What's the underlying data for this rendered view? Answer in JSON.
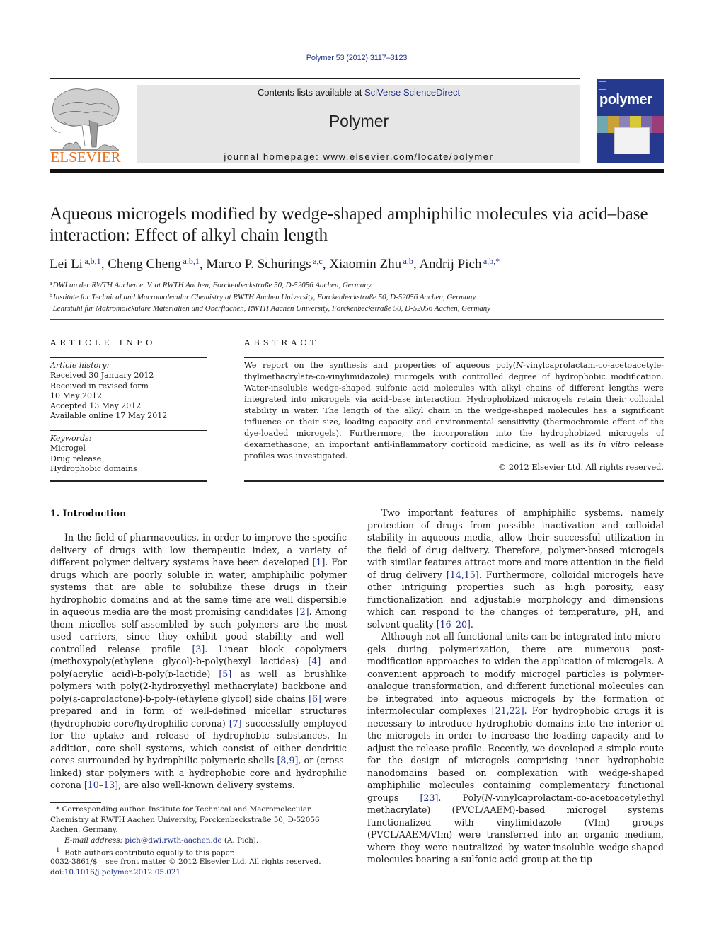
{
  "running_head": {
    "citation": "Polymer 53 (2012) 3117–3123"
  },
  "masthead": {
    "publisher_logo": "elsevier-tree-logo",
    "publisher_name": "ELSEVIER",
    "contents_prefix": "Contents lists available at ",
    "contents_link": "SciVerse ScienceDirect",
    "journal_title": "Polymer",
    "homepage_label": "journal homepage: www.elsevier.com/locate/polymer",
    "cover_title": "polymer",
    "colors": {
      "link": "#1f2f8a",
      "publisher_orange": "#e9711c",
      "masthead_bg": "#e6e6e6",
      "cover_blue": "#253a8e"
    }
  },
  "article": {
    "title": "Aqueous microgels modified by wedge-shaped amphiphilic molecules via acid–base interaction: Effect of alkyl chain length",
    "authors": [
      {
        "name": "Lei Li",
        "affil": "a,b,1",
        "sep": ", "
      },
      {
        "name": "Cheng Cheng",
        "affil": "a,b,1",
        "sep": ", "
      },
      {
        "name": "Marco P. Schürings",
        "affil": "a,c",
        "sep": ", "
      },
      {
        "name": "Xiaomin Zhu",
        "affil": "a,b",
        "sep": ", "
      },
      {
        "name": "Andrij Pich",
        "affil": "a,b,*",
        "sep": ""
      }
    ],
    "affiliations": [
      {
        "key": "a",
        "text": "DWI an der RWTH Aachen e. V. at RWTH Aachen, Forckenbeckstraße 50, D-52056 Aachen, Germany"
      },
      {
        "key": "b",
        "text": "Institute for Technical and Macromolecular Chemistry at RWTH Aachen University, Forckenbeckstraße 50, D-52056 Aachen, Germany"
      },
      {
        "key": "c",
        "text": "Lehrstuhl für Makromolekulare Materialien und Oberflächen, RWTH Aachen University, Forckenbeckstraße 50, D-52056 Aachen, Germany"
      }
    ]
  },
  "article_info": {
    "heading": "ARTICLE INFO",
    "history_label": "Article history:",
    "history": [
      "Received 30 January 2012",
      "Received in revised form",
      "10 May 2012",
      "Accepted 13 May 2012",
      "Available online 17 May 2012"
    ],
    "keywords_label": "Keywords:",
    "keywords": [
      "Microgel",
      "Drug release",
      "Hydrophobic domains"
    ]
  },
  "abstract": {
    "heading": "ABSTRACT",
    "text_1": "We report on the synthesis and properties of aqueous poly(",
    "text_1_italic": "N",
    "text_2": "-vinylcaprolactam-co-acetoacetyle­thylmethacrylate-co-vinylimidazole) microgels with controlled degree of hydrophobic modification. Water-insoluble wedge-shaped sulfonic acid molecules with alkyl chains of different lengths were integrated into microgels via acid–base interaction. Hydrophobized microgels retain their colloidal stability in water. The length of the alkyl chain in the wedge-shaped molecules has a significant influence on their size, loading capacity and environmental sensitivity (thermochromic effect of the dye-loaded microgels). Furthermore, the incorporation into the hydrophobized microgels of dexamethasone, an important anti-inflammatory corticoid medicine, as well as its ",
    "text_2_italic": "in vitro",
    "text_3": " release profiles was investigated.",
    "copyright": "© 2012 Elsevier Ltd. All rights reserved."
  },
  "body": {
    "section_heading": "1.  Introduction",
    "left_paragraph": [
      {
        "t": "In the field of pharmaceutics, in order to improve the specific delivery of drugs with low therapeutic index, a variety of different polymer delivery systems have been developed "
      },
      {
        "ref": "[1]"
      },
      {
        "t": ". For drugs which are poorly soluble in water, amphiphilic polymer systems that are able to solubilize these drugs in their hydrophobic domains and at the same time are well dispersible in aqueous media are the most promising candidates "
      },
      {
        "ref": "[2]"
      },
      {
        "t": ". Among them micelles self-assembled by such polymers are the most used carriers, since they exhibit good stability and well-controlled release profile "
      },
      {
        "ref": "[3]"
      },
      {
        "t": ". Linear block copolymers (methoxypoly(ethylene glycol)-b-poly(hexyl lactides) "
      },
      {
        "ref": "[4]"
      },
      {
        "t": " and poly(acrylic acid)-b-poly(ᴅ-lactide) "
      },
      {
        "ref": "[5]"
      },
      {
        "t": " as well as brushlike polymers with poly(2-hydroxyethyl methac­rylate) backbone and poly(ε-caprolactone)-b-poly-(ethylene glycol) side chains "
      },
      {
        "ref": "[6]"
      },
      {
        "t": " were prepared and in form of well-defined micellar structures (hydrophobic core/hydrophilic corona) "
      },
      {
        "ref": "[7]"
      },
      {
        "t": " successfully employed for the uptake and release of hydrophobic substances. In addition, core–shell systems, which consist of either dendritic cores surrounded by hydrophilic polymeric shells "
      },
      {
        "ref": "[8,9]"
      },
      {
        "t": ", or (cross-linked) star polymers with a hydrophobic core and hydrophilic corona "
      },
      {
        "ref": "[10–13]"
      },
      {
        "t": ", are also well-known delivery systems."
      }
    ],
    "right_paragraphs": [
      [
        {
          "t": "Two important features of amphiphilic systems, namely protection of drugs from possible inactivation and colloidal stability in aqueous media, allow their successful utilization in the field of drug delivery. Therefore, polymer-based microgels with similar features attract more and more attention in the field of drug delivery "
        },
        {
          "ref": "[14,15]"
        },
        {
          "t": ". Furthermore, colloidal microgels have other intriguing properties such as high porosity, easy functionalization and adjustable morphology and dimensions which can respond to the changes of temperature, pH, and solvent quality "
        },
        {
          "ref": "[16–20]"
        },
        {
          "t": "."
        }
      ],
      [
        {
          "t": "Although not all functional units can be integrated into micro­gels during polymerization, there are numerous post-modification approaches to widen the application of microgels. A convenient approach to modify microgel particles is polymer-analogue trans­formation, and different functional molecules can be integrated into aqueous microgels by the formation of intermolecular complexes "
        },
        {
          "ref": "[21,22]"
        },
        {
          "t": ". For hydrophobic drugs it is necessary to intro­duce hydrophobic domains into the interior of the microgels in order to increase the loading capacity and to adjust the release profile. Recently, we developed a simple route for the design of microgels comprising inner hydrophobic nanodomains based on complexation with wedge-shaped amphiphilic molecules con­taining complementary functional groups "
        },
        {
          "ref": "[23]"
        },
        {
          "t": ". Poly("
        },
        {
          "i": "N"
        },
        {
          "t": "-vinyl­caprolactam-co-acetoacetylethyl methacrylate) (PVCL/AAEM)-based microgel systems functionalized with vinylimidazole (VIm) groups (PVCL/AAEM/VIm) were transferred into an organic medium, where they were neutralized by water-insoluble wedge-shaped molecules bearing a sulfonic acid group at the tip"
        }
      ]
    ]
  },
  "footnotes": {
    "corresponding_marker": "*",
    "corresponding_text": "Corresponding author. Institute for Technical and Macromolecular Chemistry at RWTH Aachen University, Forckenbeckstraße 50, D-52056 Aachen, Germany.",
    "email_label": "E-mail address: ",
    "email": "pich@dwi.rwth-aachen.de",
    "email_suffix": " (A. Pich).",
    "equal_marker": "1",
    "equal_text": "Both authors contribute equally to this paper.",
    "front_matter": "0032-3861/$ – see front matter © 2012 Elsevier Ltd. All rights reserved.",
    "doi_label": "doi:",
    "doi": "10.1016/j.polymer.2012.05.021"
  }
}
